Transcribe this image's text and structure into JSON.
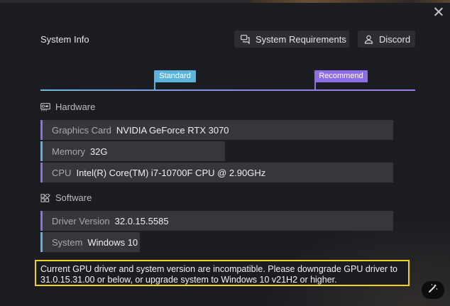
{
  "header": {
    "title": "System Info",
    "system_requirements_label": "System Requirements",
    "discord_label": "Discord"
  },
  "tiers": {
    "standard_label": "Standard",
    "recommend_label": "Recommend"
  },
  "hardware": {
    "section_label": "Hardware",
    "items": [
      {
        "label": "Graphics Card",
        "value": "NVIDIA GeForce RTX 3070",
        "status": "recommend"
      },
      {
        "label": "Memory",
        "value": "32G",
        "status": "standard"
      },
      {
        "label": "CPU",
        "value": "Intel(R) Core(TM) i7-10700F CPU @ 2.90GHz",
        "status": "recommend"
      }
    ]
  },
  "software": {
    "section_label": "Software",
    "items": [
      {
        "label": "Driver Version",
        "value": "32.0.15.5585",
        "status": "recommend"
      },
      {
        "label": "System",
        "value": "Windows 10",
        "status": "standard"
      }
    ]
  },
  "warning": {
    "text": "Current GPU driver and system version are incompatible. Please downgrade GPU driver to 31.0.15.31.00 or below, or upgrade system to Windows 10 v21H2 or higher."
  },
  "colors": {
    "standard": "#5bb3dc",
    "recommend": "#8f6fe8",
    "warning_border": "#f2d21c"
  },
  "icons": {
    "close": "close-icon",
    "requirements": "chat-bubbles-icon",
    "discord": "person-icon",
    "hardware": "gpu-card-icon",
    "software": "apps-grid-icon",
    "magic": "magic-wand-icon"
  }
}
